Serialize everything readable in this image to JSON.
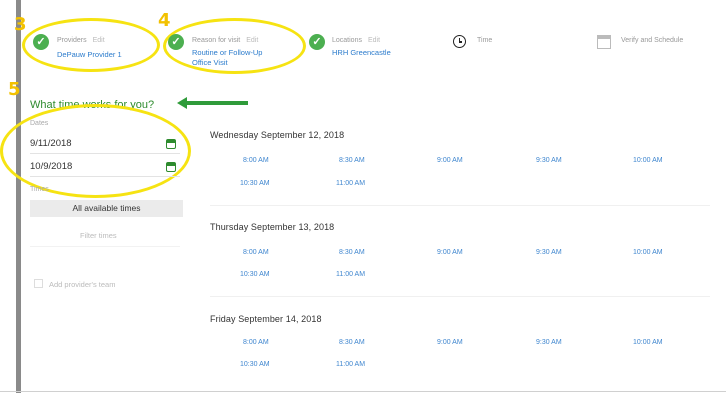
{
  "steps": [
    {
      "number": "3",
      "label": "Providers",
      "edit": "Edit",
      "value_lines": [
        "DePauw Provider 1"
      ]
    },
    {
      "number": "4",
      "label": "Reason for visit",
      "edit": "Edit",
      "value_lines": [
        "Routine or Follow-Up",
        "Office Visit"
      ]
    },
    {
      "label": "Locations",
      "edit": "Edit",
      "value_lines": [
        "HRH Greencastle"
      ]
    },
    {
      "label": "Time",
      "icon": "clock-icon"
    },
    {
      "label": "Verify and Schedule",
      "icon": "calendar-icon"
    }
  ],
  "sidebar": {
    "step_number": "5",
    "title": "What time works for you?",
    "dates_label": "Dates",
    "start_date": "9/11/2018",
    "end_date": "10/9/2018",
    "times_label": "Times",
    "all_times_button": "All available times",
    "filter_times": "Filter times",
    "add_team": "Add provider's team"
  },
  "days": [
    {
      "heading": "Wednesday September 12, 2018",
      "slots": [
        "8:00 AM",
        "8:30 AM",
        "9:00 AM",
        "9:30 AM",
        "10:00 AM",
        "10:30 AM",
        "11:00 AM"
      ]
    },
    {
      "heading": "Thursday September 13, 2018",
      "slots": [
        "8:00 AM",
        "8:30 AM",
        "9:00 AM",
        "9:30 AM",
        "10:00 AM",
        "10:30 AM",
        "11:00 AM"
      ]
    },
    {
      "heading": "Friday September 14, 2018",
      "slots": [
        "8:00 AM",
        "8:30 AM",
        "9:00 AM",
        "9:30 AM",
        "10:00 AM",
        "10:30 AM",
        "11:00 AM"
      ]
    }
  ],
  "colors": {
    "annotation": "#f6e312",
    "accent_green": "#2e8b2e",
    "link_blue": "#2b7bcc",
    "check_green": "#4caf50"
  }
}
